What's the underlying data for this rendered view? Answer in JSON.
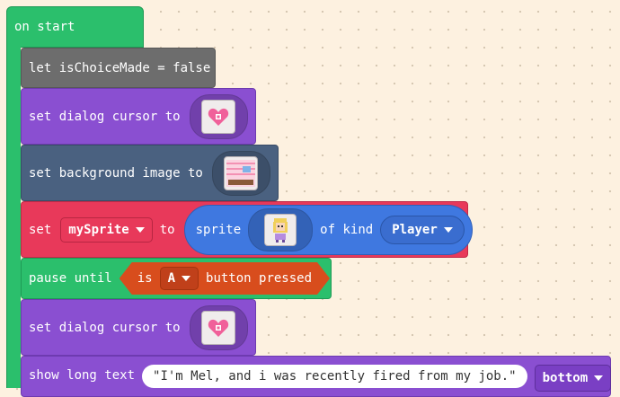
{
  "on_start": {
    "label": "on start"
  },
  "let_block": {
    "text": "let isChoiceMade = false"
  },
  "dialog_cursor_1": {
    "text": "set dialog cursor to",
    "icon": "heart-cursor-icon"
  },
  "background_block": {
    "text": "set background image to",
    "icon": "room-background-icon"
  },
  "set_sprite": {
    "set_label": "set",
    "variable": "mySprite",
    "to_label": "to",
    "sprite_label": "sprite",
    "sprite_icon": "character-sprite-icon",
    "kind_label": "of kind",
    "kind": "Player"
  },
  "pause_block": {
    "label": "pause until",
    "is_label": "is",
    "button": "A",
    "pressed_label": "button pressed"
  },
  "dialog_cursor_2": {
    "text": "set dialog cursor to",
    "icon": "heart-cursor-icon"
  },
  "show_text": {
    "label": "show long text",
    "value": "\"I'm Mel, and i was recently fired from my job.\"",
    "position": "bottom"
  },
  "colors": {
    "green": "#2bbf6c",
    "grey": "#6d6d6d",
    "purple": "#8a4fd1",
    "slate": "#4a6180",
    "red": "#e8395a",
    "blue": "#3f78e0",
    "orange": "#d84d1d",
    "background": "#fdf1e0"
  }
}
